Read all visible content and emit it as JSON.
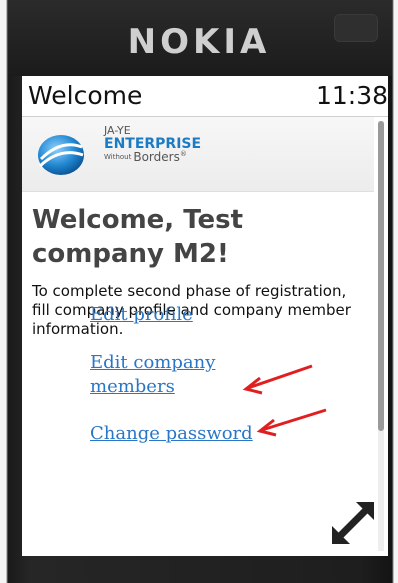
{
  "device": {
    "brand": "NOKIA"
  },
  "statusbar": {
    "title": "Welcome",
    "time": "11:38"
  },
  "logo": {
    "line1": "JA-YE",
    "line2": "ENTERPRISE",
    "line3_small": "Without",
    "line3": "Borders",
    "line3_mark": "®"
  },
  "main": {
    "heading": "Welcome, Test company M2!",
    "description": "To complete second phase of registration, fill company profile and company member information."
  },
  "links": {
    "edit_profile": "Edit profile",
    "edit_members": "Edit company members",
    "change_password": "Change password"
  },
  "colors": {
    "link": "#2a76c6",
    "annotation_arrow": "#e02020",
    "brand_blue": "#1c7cc3"
  },
  "scroll": {
    "position_fraction": 0.0,
    "visible_fraction": 0.72
  }
}
